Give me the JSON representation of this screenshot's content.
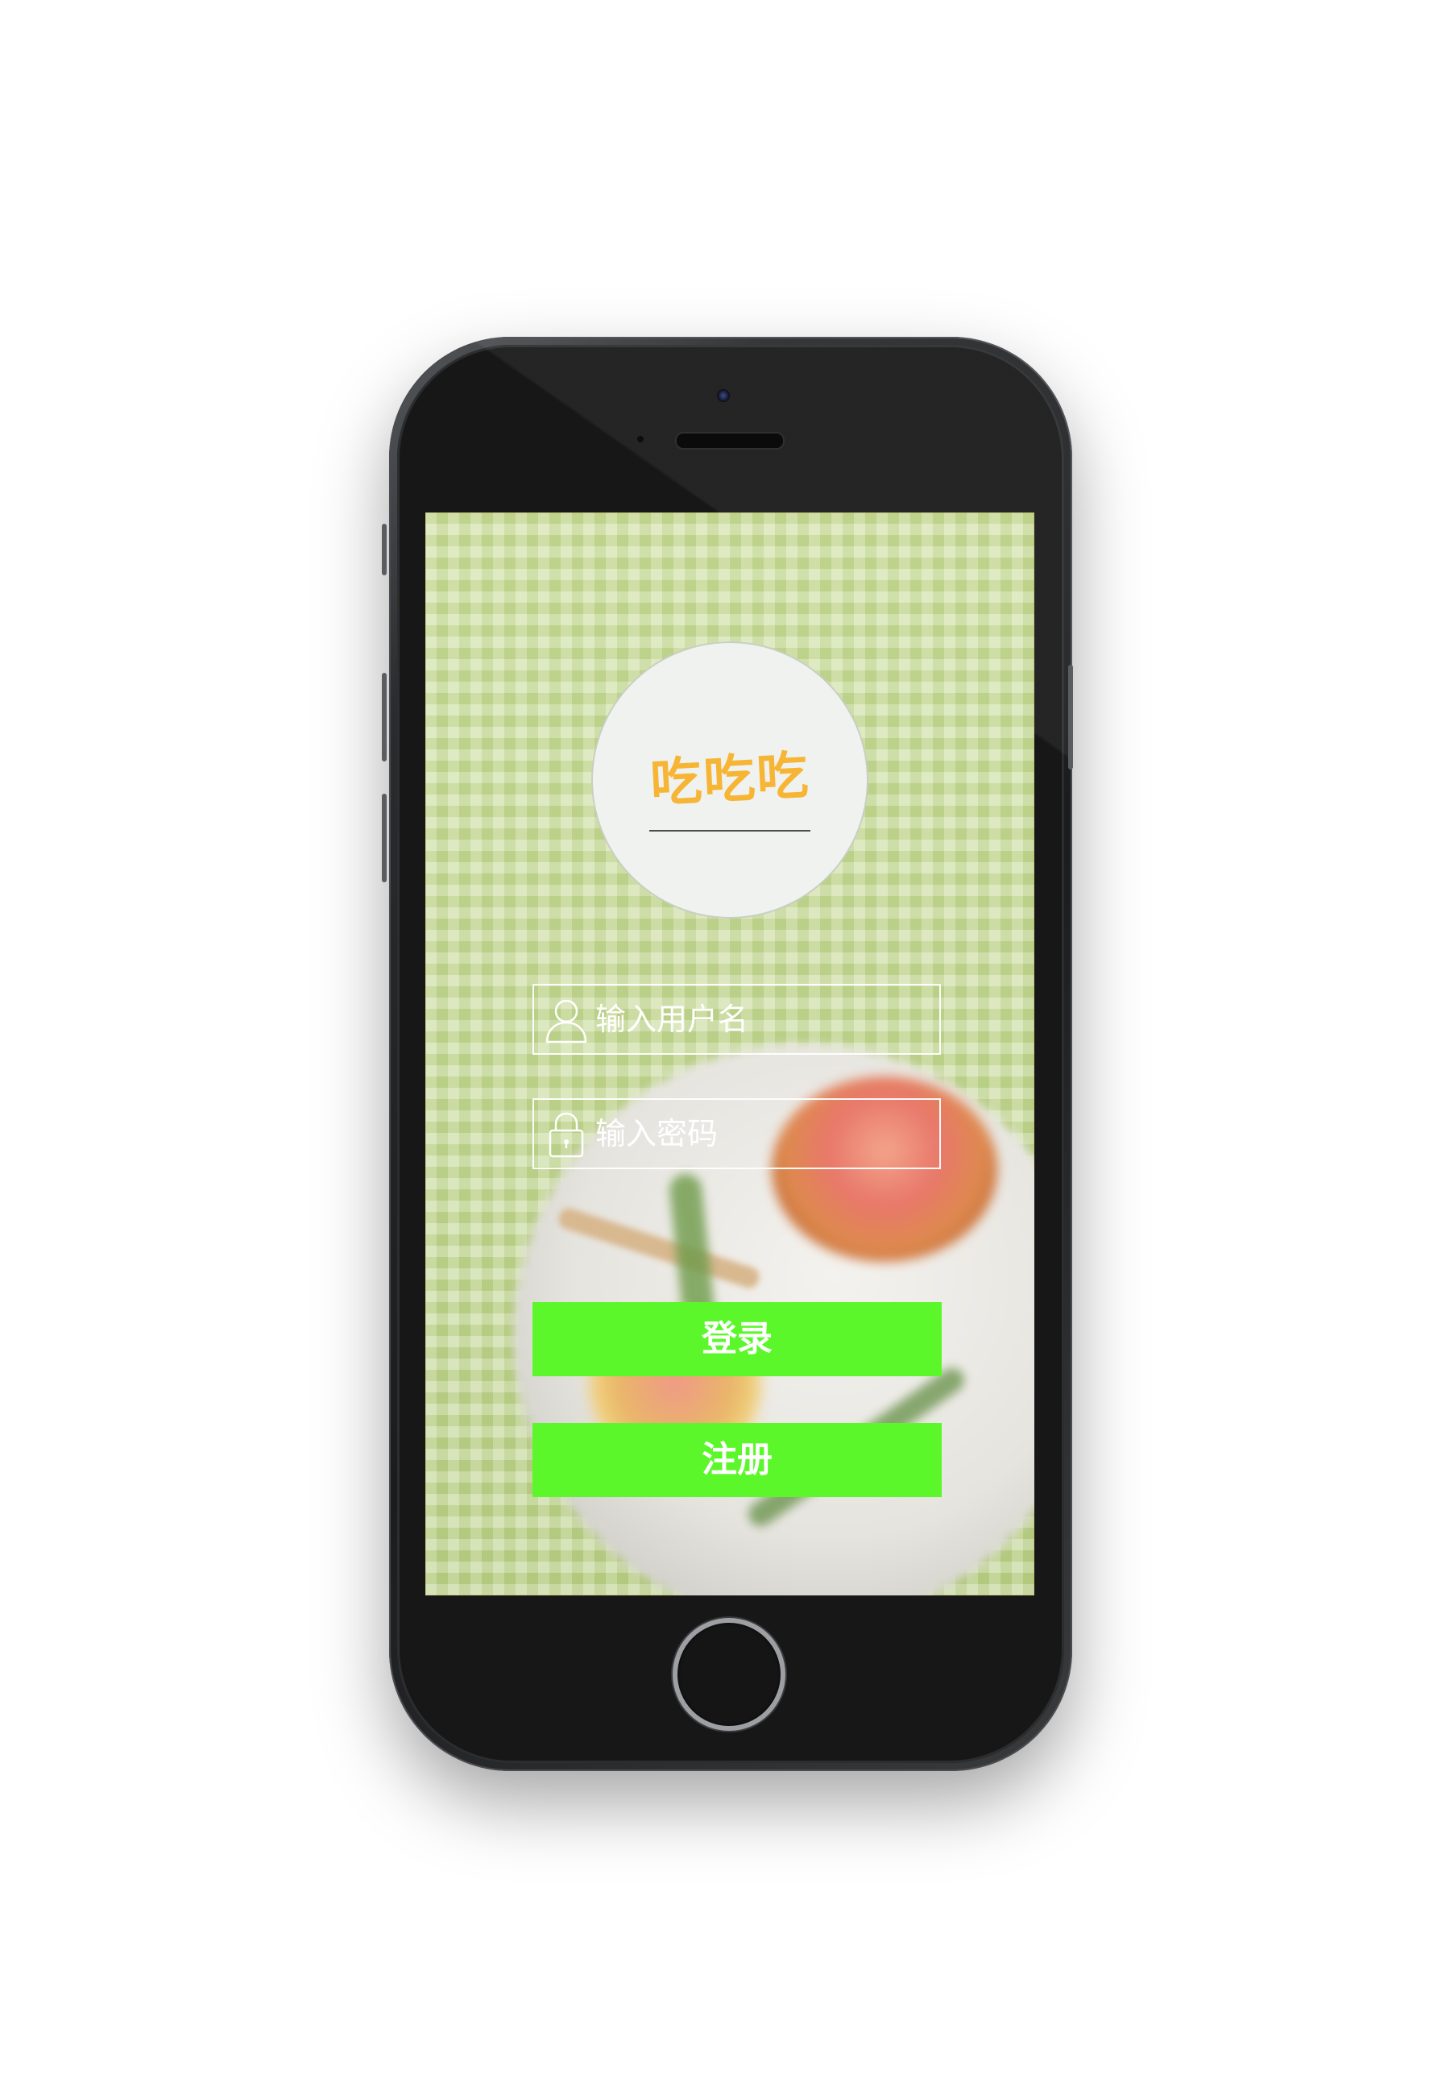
{
  "app": {
    "logo_text": "吃吃吃"
  },
  "login_form": {
    "username_placeholder": "输入用户名",
    "password_placeholder": "输入密码",
    "login_label": "登录",
    "register_label": "注册"
  },
  "icons": {
    "username": "user-icon",
    "password": "lock-icon"
  },
  "colors": {
    "logo": "#f7b536",
    "button": "#5cf72a",
    "background_tint": "#c9dc9c"
  }
}
